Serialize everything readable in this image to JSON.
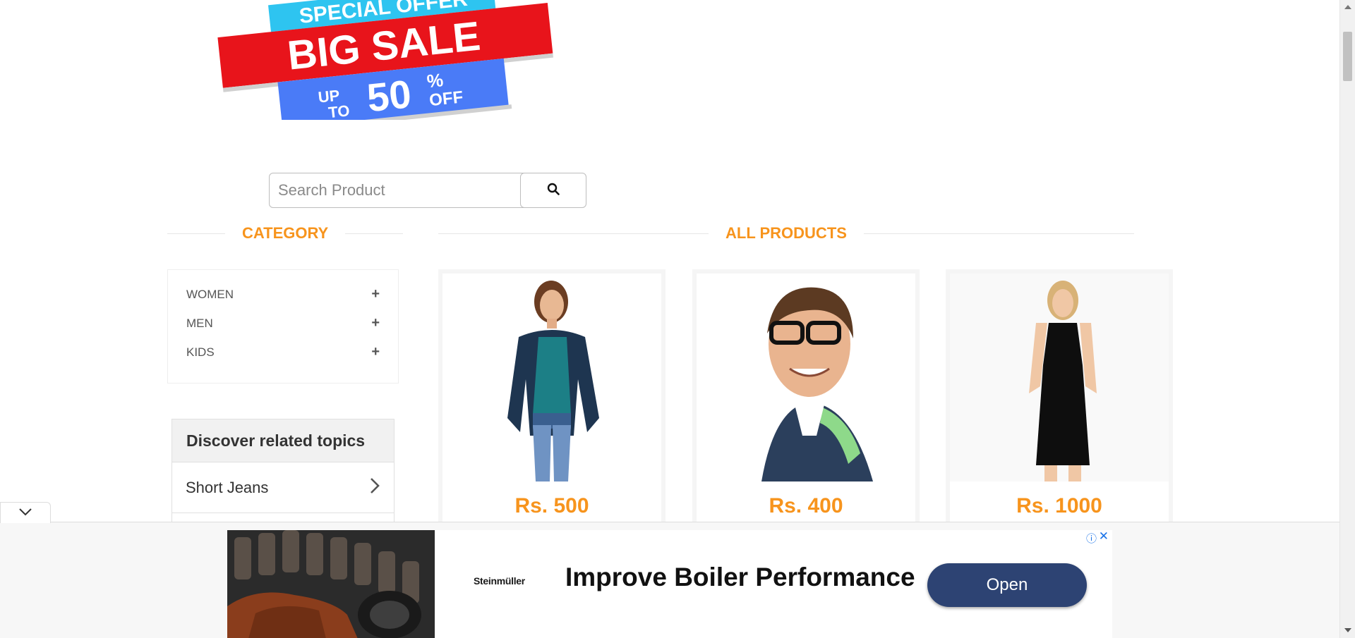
{
  "banner": {
    "line1": "SPECIAL OFFER",
    "line2": "BIG SALE",
    "up": "UP",
    "to": "TO",
    "percent_value": "50",
    "percent_sign": "%",
    "off": "OFF"
  },
  "search": {
    "placeholder": "Search Product",
    "value": ""
  },
  "sections": {
    "category_title": "CATEGORY",
    "products_title": "ALL PRODUCTS"
  },
  "categories": [
    {
      "label": "WOMEN"
    },
    {
      "label": "MEN"
    },
    {
      "label": "KIDS"
    }
  ],
  "related": {
    "heading": "Discover related topics",
    "items": [
      {
        "label": "Short Jeans"
      }
    ]
  },
  "products": [
    {
      "price": "Rs. 500"
    },
    {
      "price": "Rs. 400"
    },
    {
      "price": "Rs. 1000"
    }
  ],
  "ad": {
    "brand": "Steinmüller",
    "headline": "Improve Boiler Performance",
    "cta": "Open"
  },
  "colors": {
    "accent": "#f7941d",
    "ad_button": "#2d4373",
    "sale_red": "#e8141b",
    "sale_blue": "#4a7bf7",
    "sale_cyan": "#2ec4f0"
  }
}
